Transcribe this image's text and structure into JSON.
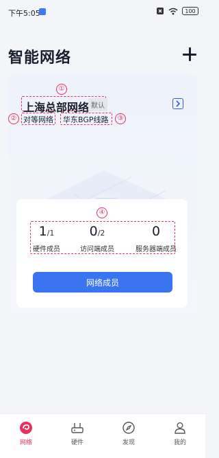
{
  "status_bar": {
    "time": "下午5:05",
    "battery": "100"
  },
  "header": {
    "title": "智能网络"
  },
  "network": {
    "name": "上海总部网络",
    "default_badge": "默认",
    "type": "对等网络",
    "line": "华东BGP线路"
  },
  "stats": [
    {
      "value": "1",
      "total": "/1",
      "label": "硬件成员"
    },
    {
      "value": "0",
      "total": "/2",
      "label": "访问端成员"
    },
    {
      "value": "0",
      "total": "",
      "label": "服务器端成员"
    }
  ],
  "members_button": "网络成员",
  "annotations": [
    "①",
    "②",
    "③",
    "④"
  ],
  "bottom_nav": [
    {
      "label": "网络",
      "icon": "network-icon",
      "active": true
    },
    {
      "label": "硬件",
      "icon": "router-icon",
      "active": false
    },
    {
      "label": "发现",
      "icon": "compass-icon",
      "active": false
    },
    {
      "label": "我的",
      "icon": "profile-icon",
      "active": false
    }
  ],
  "colors": {
    "accent": "#e8305a",
    "primary_button": "#3b74f0",
    "annotation": "#e8305a"
  }
}
